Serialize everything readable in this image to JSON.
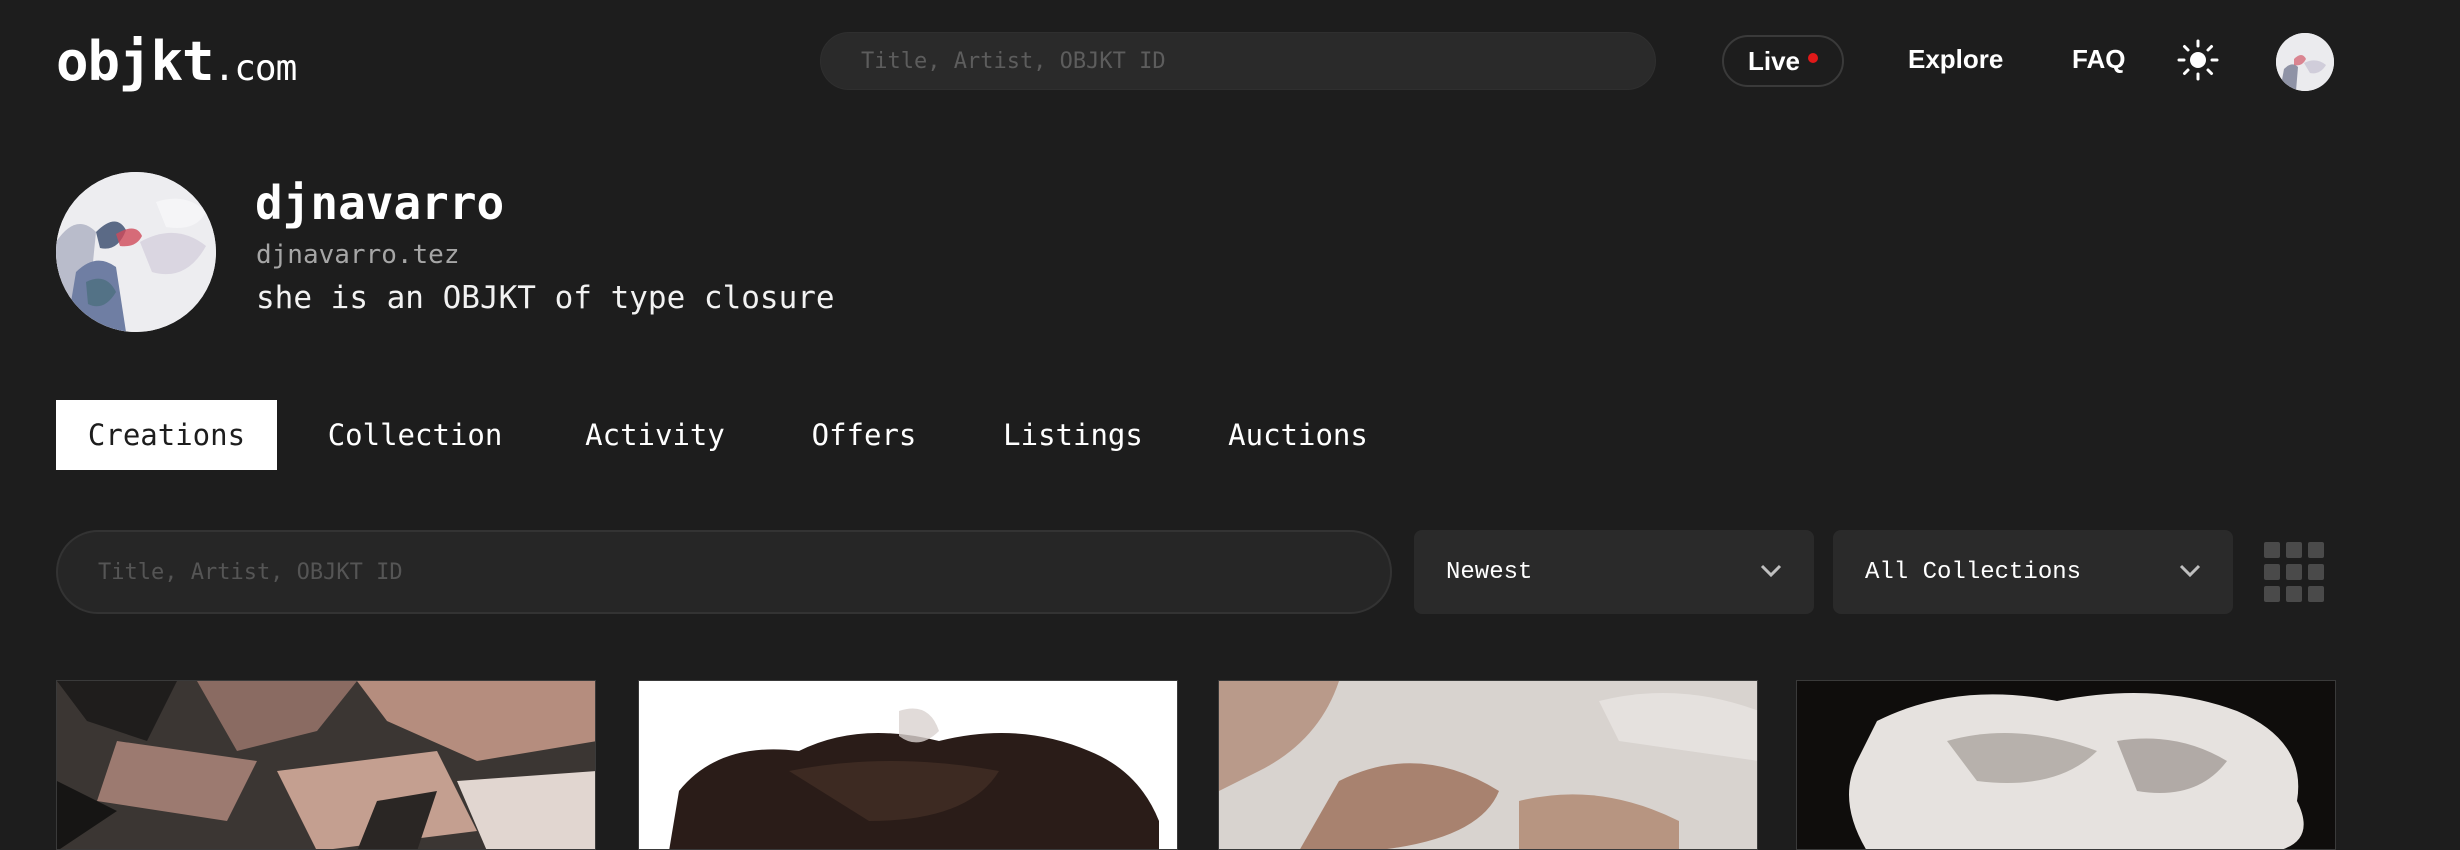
{
  "header": {
    "logo_main": "objkt",
    "logo_suffix": ".com",
    "search_placeholder": "Title, Artist, OBJKT ID",
    "live_label": "Live",
    "nav": [
      "Explore",
      "FAQ"
    ],
    "theme_icon": "sun-icon"
  },
  "profile": {
    "name": "djnavarro",
    "tez": "djnavarro.tez",
    "bio": "she is an OBJKT of type closure"
  },
  "tabs": [
    "Creations",
    "Collection",
    "Activity",
    "Offers",
    "Listings",
    "Auctions"
  ],
  "active_tab": "Creations",
  "filters": {
    "search_placeholder": "Title, Artist, OBJKT ID",
    "sort_value": "Newest",
    "collection_value": "All Collections",
    "view_icon": "grid-icon"
  },
  "colors": {
    "background": "#1d1d1d",
    "live_dot": "#e01919",
    "active_tab_bg": "#ffffff"
  }
}
